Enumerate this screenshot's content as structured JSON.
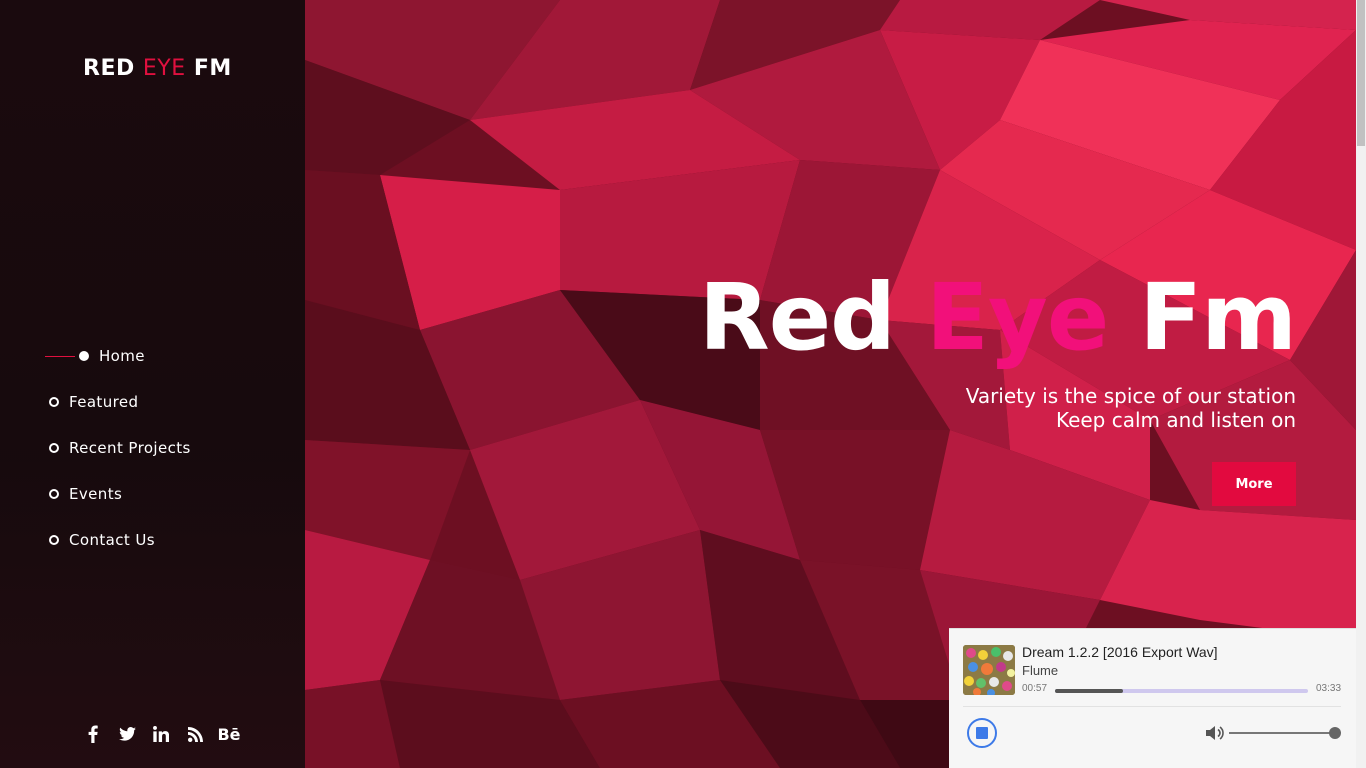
{
  "brand": {
    "part1": "RED",
    "part2": "EYE",
    "part3": "FM"
  },
  "nav": {
    "items": [
      {
        "label": "Home",
        "active": true
      },
      {
        "label": "Featured",
        "active": false
      },
      {
        "label": "Recent Projects",
        "active": false
      },
      {
        "label": "Events",
        "active": false
      },
      {
        "label": "Contact Us",
        "active": false
      }
    ]
  },
  "social": {
    "icons": [
      "facebook-icon",
      "twitter-icon",
      "linkedin-icon",
      "rss-icon",
      "behance-icon"
    ],
    "glyphs": [
      "f",
      "🐦",
      "in",
      "◉",
      "Bē"
    ]
  },
  "hero": {
    "title_part1": "Red",
    "title_part2": "Eye",
    "title_part3": "Fm",
    "subtitle_line1": "Variety is the spice of our station",
    "subtitle_line2": "Keep calm and listen on",
    "button_label": "More"
  },
  "player": {
    "track_title": "Dream 1.2.2 [2016 Export Wav]",
    "artist": "Flume",
    "current_time": "00:57",
    "duration": "03:33",
    "progress_fraction": 0.27,
    "volume_fraction": 1.0
  },
  "colors": {
    "accent_red": "#e20a3f",
    "accent_pink": "#f2107a",
    "player_blue": "#3d7ae8"
  }
}
